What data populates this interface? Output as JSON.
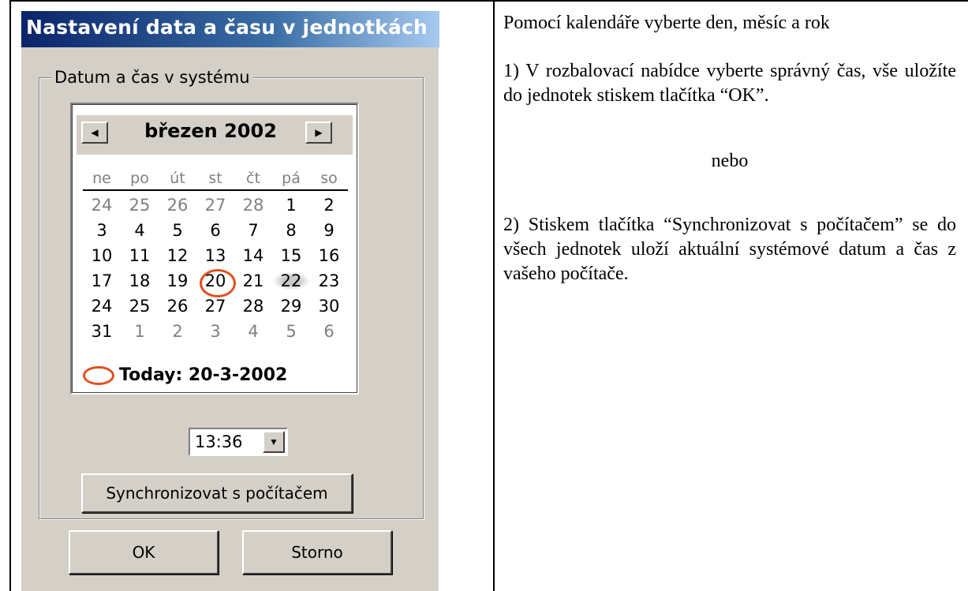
{
  "dialog": {
    "title": "Nastavení data a času v jednotkách",
    "group_label": "Datum a čas v systému",
    "calendar": {
      "month_label": "březen 2002",
      "prev_icon": "left-arrow-icon",
      "next_icon": "right-arrow-icon",
      "weekdays": [
        "ne",
        "po",
        "út",
        "st",
        "čt",
        "pá",
        "so"
      ],
      "weeks": [
        [
          "24",
          "25",
          "26",
          "27",
          "28",
          "1",
          "2"
        ],
        [
          "3",
          "4",
          "5",
          "6",
          "7",
          "8",
          "9"
        ],
        [
          "10",
          "11",
          "12",
          "13",
          "14",
          "15",
          "16"
        ],
        [
          "17",
          "18",
          "19",
          "20",
          "21",
          "22",
          "23"
        ],
        [
          "24",
          "25",
          "26",
          "27",
          "28",
          "29",
          "30"
        ],
        [
          "31",
          "1",
          "2",
          "3",
          "4",
          "5",
          "6"
        ]
      ],
      "today_label": "Today: 20-3-2002",
      "highlight_color": "#e05020"
    },
    "time_value": "13:36",
    "sync_button": "Synchronizovat s počítačem",
    "ok_button": "OK",
    "cancel_button": "Storno"
  },
  "instructions": {
    "intro": "Pomocí kalendáře vyberte den, měsíc a rok",
    "step1": "1) V rozbalovací nabídce vyberte správný čas, vše uložíte do jednotek stiskem tlačítka “OK”.",
    "or": "nebo",
    "step2": "2) Stiskem tlačítka “Synchronizovat s počítačem” se do všech jednotek uloží aktuální systémové datum a čas z vašeho počítače."
  }
}
